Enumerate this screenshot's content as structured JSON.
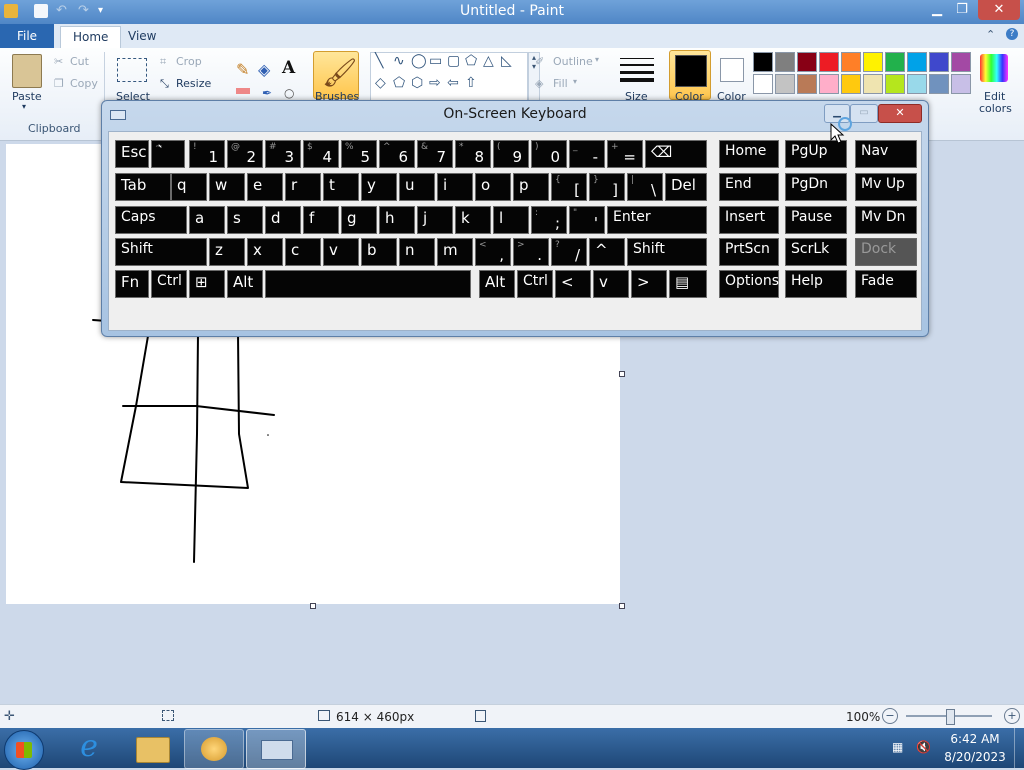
{
  "window": {
    "title": "Untitled - Paint"
  },
  "ribbon": {
    "tabs": {
      "file": "File",
      "home": "Home",
      "view": "View"
    },
    "clipboard": {
      "paste": "Paste",
      "cut": "Cut",
      "copy": "Copy",
      "group": "Clipboard"
    },
    "image": {
      "select": "Select",
      "crop": "Crop",
      "resize": "Resize"
    },
    "brushes": "Brushes",
    "outline": "Outline",
    "fill": "Fill",
    "size": "Size",
    "color1": "Color",
    "color2": "Color",
    "edit_colors_1": "Edit",
    "edit_colors_2": "colors",
    "palette": [
      "#000000",
      "#7f7f7f",
      "#880015",
      "#ed1c24",
      "#ff7f27",
      "#fff200",
      "#22b14c",
      "#00a2e8",
      "#3f48cc",
      "#a349a4",
      "#ffffff",
      "#c3c3c3",
      "#b97a57",
      "#ffaec9",
      "#ffc90e",
      "#efe4b0",
      "#b5e61d",
      "#99d9ea",
      "#7092be",
      "#c8bfe7"
    ]
  },
  "osk": {
    "title": "On-Screen Keyboard",
    "rows": [
      [
        {
          "l": "Esc"
        },
        {
          "s": "~",
          "l": "`"
        },
        {
          "s": "!",
          "d": "1"
        },
        {
          "s": "@",
          "d": "2"
        },
        {
          "s": "#",
          "d": "3"
        },
        {
          "s": "$",
          "d": "4"
        },
        {
          "s": "%",
          "d": "5"
        },
        {
          "s": "^",
          "d": "6"
        },
        {
          "s": "&",
          "d": "7"
        },
        {
          "s": "*",
          "d": "8"
        },
        {
          "s": "(",
          "d": "9"
        },
        {
          "s": ")",
          "d": "0"
        },
        {
          "s": "_",
          "d": "-"
        },
        {
          "s": "+",
          "d": "="
        },
        {
          "l": "⌫"
        }
      ],
      [
        {
          "l": "Tab"
        },
        {
          "l": "q"
        },
        {
          "l": "w"
        },
        {
          "l": "e"
        },
        {
          "l": "r"
        },
        {
          "l": "t"
        },
        {
          "l": "y"
        },
        {
          "l": "u"
        },
        {
          "l": "i"
        },
        {
          "l": "o"
        },
        {
          "l": "p"
        },
        {
          "s": "{",
          "d": "["
        },
        {
          "s": "}",
          "d": "]"
        },
        {
          "s": "|",
          "d": "\\"
        },
        {
          "l": "Del"
        }
      ],
      [
        {
          "l": "Caps"
        },
        {
          "l": "a"
        },
        {
          "l": "s"
        },
        {
          "l": "d"
        },
        {
          "l": "f"
        },
        {
          "l": "g"
        },
        {
          "l": "h"
        },
        {
          "l": "j"
        },
        {
          "l": "k"
        },
        {
          "l": "l"
        },
        {
          "s": ":",
          "d": ";"
        },
        {
          "s": "\"",
          "d": "'"
        },
        {
          "l": "Enter"
        }
      ],
      [
        {
          "l": "Shift"
        },
        {
          "l": "z"
        },
        {
          "l": "x"
        },
        {
          "l": "c"
        },
        {
          "l": "v"
        },
        {
          "l": "b"
        },
        {
          "l": "n"
        },
        {
          "l": "m"
        },
        {
          "s": "<",
          "d": ","
        },
        {
          "s": ">",
          "d": "."
        },
        {
          "s": "?",
          "d": "/"
        },
        {
          "l": "^"
        },
        {
          "l": "Shift"
        }
      ],
      [
        {
          "l": "Fn"
        },
        {
          "l": "Ctrl"
        },
        {
          "l": "⊞"
        },
        {
          "l": "Alt"
        },
        {
          "l": ""
        },
        {
          "l": "Alt"
        },
        {
          "l": "Ctrl"
        },
        {
          "l": "<"
        },
        {
          "l": "v"
        },
        {
          "l": ">"
        },
        {
          "l": "▤"
        }
      ]
    ],
    "nav": [
      [
        "Home",
        "PgUp",
        "Nav"
      ],
      [
        "End",
        "PgDn",
        "Mv Up"
      ],
      [
        "Insert",
        "Pause",
        "Mv Dn"
      ],
      [
        "PrtScn",
        "ScrLk",
        "Dock"
      ],
      [
        "Options",
        "Help",
        "Fade"
      ]
    ]
  },
  "status": {
    "dimensions": "614 × 460px",
    "zoom": "100%"
  },
  "clock": {
    "time": "6:42 AM",
    "date": "8/20/2023"
  }
}
